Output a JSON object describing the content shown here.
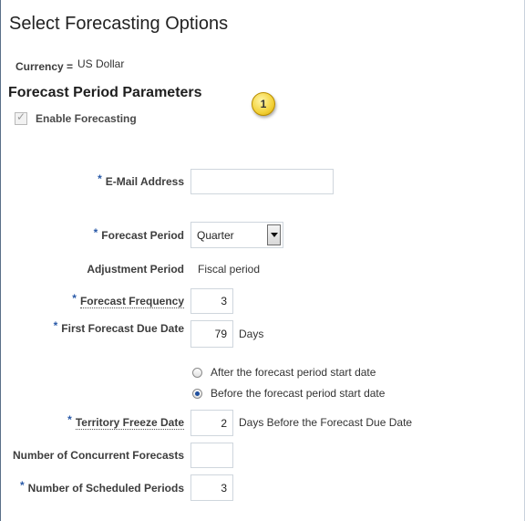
{
  "page": {
    "title": "Select Forecasting Options",
    "currency_label": "Currency =",
    "currency_value": "US Dollar",
    "section_title": "Forecast Period Parameters",
    "callout_number": "1",
    "enable_forecasting": {
      "label": "Enable Forecasting",
      "checked": true,
      "disabled": true
    }
  },
  "form": {
    "required_marker": "*",
    "email": {
      "label": "E-Mail Address",
      "value": ""
    },
    "forecast_period": {
      "label": "Forecast Period",
      "selected": "Quarter"
    },
    "adjustment_period": {
      "label": "Adjustment Period",
      "value": "Fiscal period"
    },
    "forecast_frequency": {
      "label": "Forecast Frequency",
      "value": "3"
    },
    "first_forecast_due_date": {
      "label": "First Forecast Due Date",
      "value": "79",
      "unit": "Days"
    },
    "due_date_options": [
      {
        "label": "After the forecast period start date",
        "selected": false
      },
      {
        "label": "Before the forecast period start date",
        "selected": true
      }
    ],
    "territory_freeze_date": {
      "label": "Territory Freeze Date",
      "value": "2",
      "unit": "Days Before the Forecast Due Date"
    },
    "number_of_concurrent_forecasts": {
      "label": "Number of Concurrent Forecasts",
      "value": ""
    },
    "number_of_scheduled_periods": {
      "label": "Number of Scheduled Periods",
      "value": "3"
    }
  },
  "colors": {
    "required": "#2a5aa8",
    "callout": "#f3d23a",
    "frame": "#5a6f88"
  }
}
